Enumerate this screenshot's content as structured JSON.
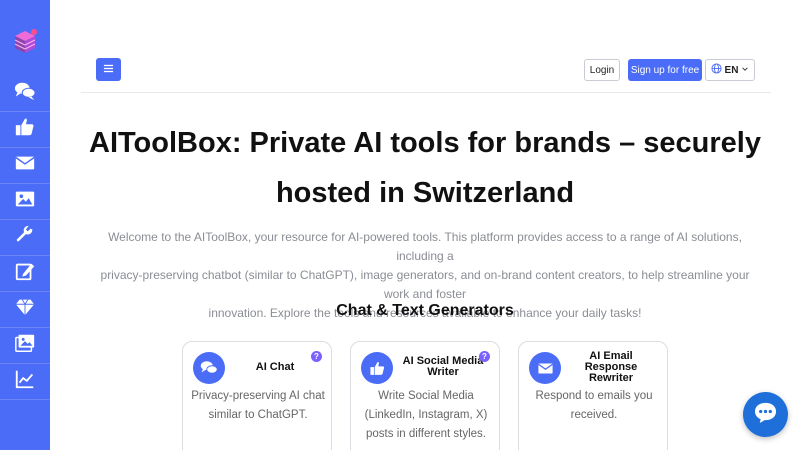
{
  "sidebar": {
    "logo_icon": "stacked-cubes-logo-icon",
    "items": [
      {
        "icon": "chat-bubbles-icon"
      },
      {
        "icon": "thumbs-up-icon"
      },
      {
        "icon": "envelope-icon"
      },
      {
        "icon": "image-icon"
      },
      {
        "icon": "wrench-icon"
      },
      {
        "icon": "edit-icon"
      },
      {
        "icon": "diamond-icon"
      },
      {
        "icon": "images-icon"
      },
      {
        "icon": "line-chart-icon"
      }
    ]
  },
  "header": {
    "menu_icon": "hamburger-icon",
    "login_label": "Login",
    "signup_label": "Sign up for free",
    "language": "EN",
    "language_icon": "globe-icon"
  },
  "hero": {
    "title_line1": "AIToolBox: Private AI tools for brands – securely",
    "title_line2": "hosted in Switzerland",
    "desc_line1": "Welcome to the AIToolBox, your resource for AI-powered tools. This platform provides access to a range of AI solutions, including a",
    "desc_line2": "privacy-preserving chatbot (similar to ChatGPT), image generators, and on-brand content creators, to help streamline your work and foster",
    "desc_line3": "innovation. Explore the tools and resources available to enhance your daily tasks!"
  },
  "section": {
    "title": "Chat & Text Generators"
  },
  "cards": [
    {
      "title_lines": [
        "AI Chat"
      ],
      "desc_lines": [
        "Privacy-preserving AI chat",
        "similar to ChatGPT."
      ],
      "icon": "chat-bubbles-icon",
      "help": "?"
    },
    {
      "title_lines": [
        "AI Social Media",
        "Writer"
      ],
      "desc_lines": [
        "Write Social Media",
        "(LinkedIn, Instagram, X)",
        "posts in different styles."
      ],
      "icon": "thumbs-up-icon",
      "help": "?"
    },
    {
      "title_lines": [
        "AI Email",
        "Response",
        "Rewriter"
      ],
      "desc_lines": [
        "Respond to emails you",
        "received."
      ],
      "icon": "envelope-icon"
    }
  ],
  "chat_widget": {
    "icon": "chat-bubble-dots-icon"
  },
  "colors": {
    "accent": "#4a6cf7",
    "help_badge": "#7b61ff",
    "chat_fab": "#1e6fd9"
  }
}
